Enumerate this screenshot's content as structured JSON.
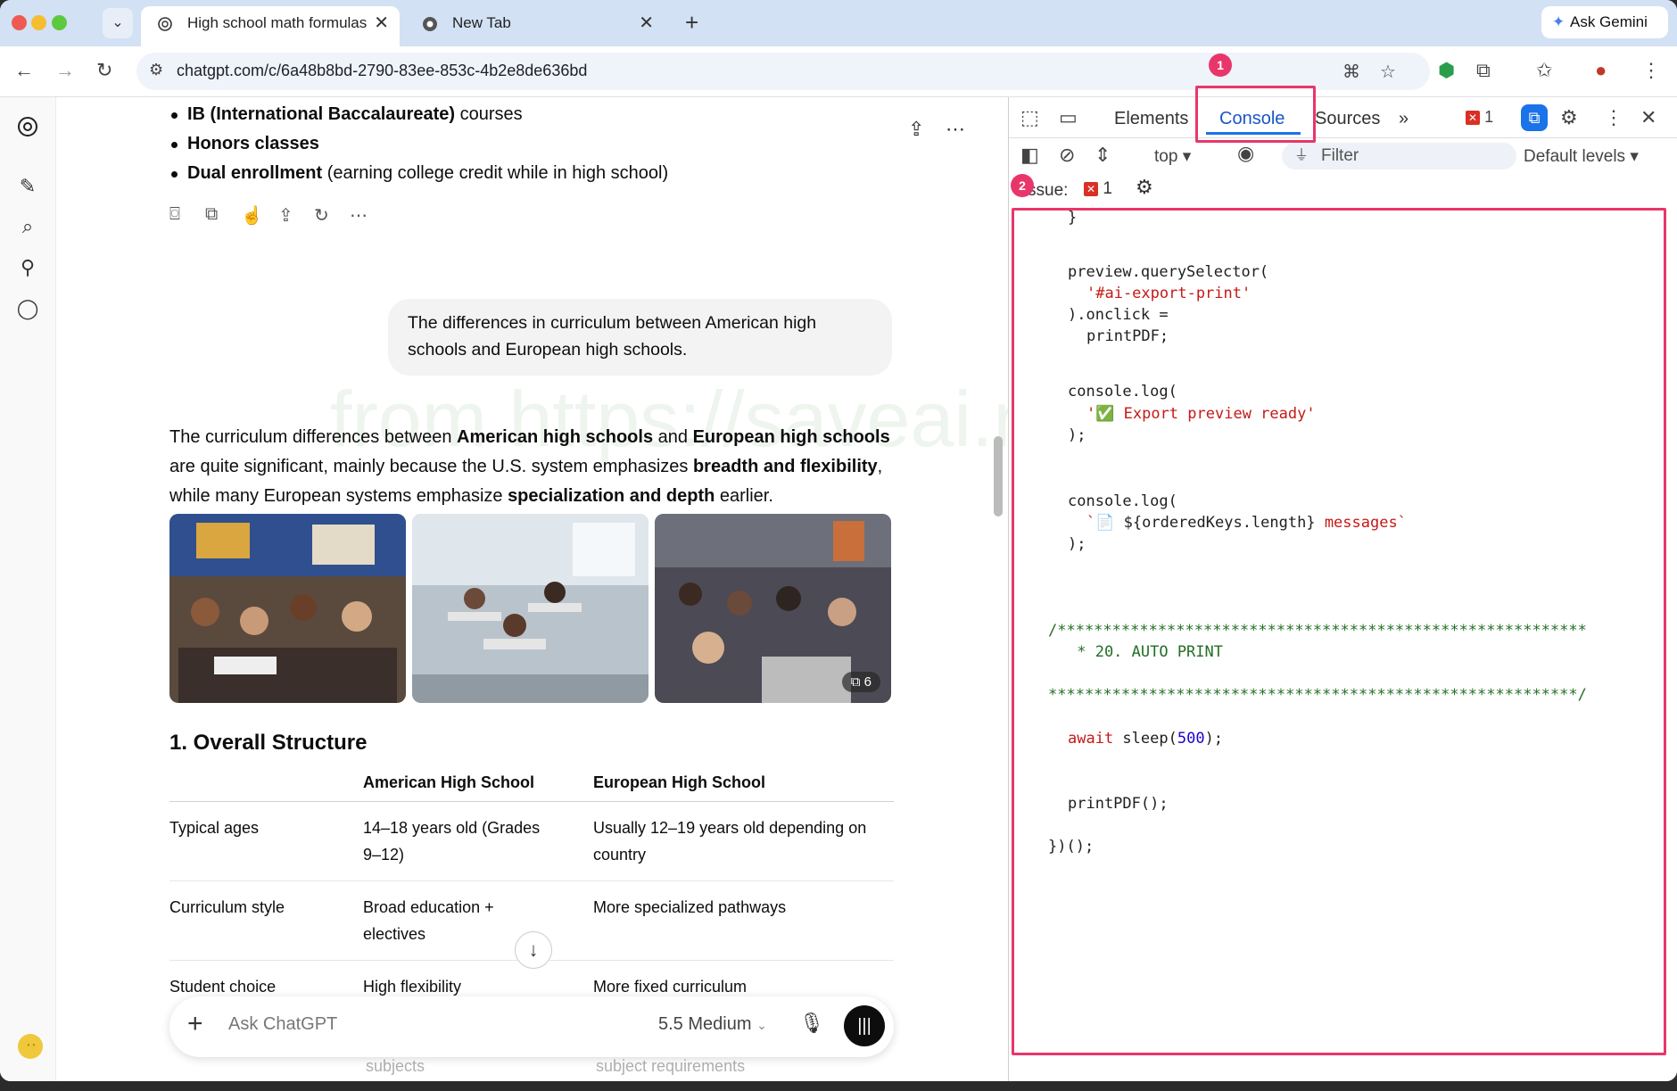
{
  "browser": {
    "tabs": [
      {
        "title": "High school math formulas",
        "active": true
      },
      {
        "title": "New Tab",
        "active": false
      }
    ],
    "ask_gemini": "Ask Gemini",
    "url": "chatgpt.com/c/6a48b8bd-2790-83ee-853c-4b2e8de636bd"
  },
  "chat": {
    "bullets": [
      {
        "bold": "IB (International Baccalaureate)",
        "rest": " courses"
      },
      {
        "bold": "Honors classes",
        "rest": ""
      },
      {
        "bold": "Dual enrollment",
        "rest": " (earning college credit while in high school)"
      }
    ],
    "user_message": "The differences in curriculum between American high schools and European high schools.",
    "response_intro": {
      "p1": "The curriculum differences between ",
      "b1": "American high schools",
      "p2": " and ",
      "b2": "European high schools",
      "p3": " are quite significant, mainly because the U.S. system emphasizes ",
      "b3": "breadth and flexibility",
      "p4": ", while many European systems emphasize ",
      "b4": "specialization and depth",
      "p5": " earlier."
    },
    "image_count": "6",
    "section_heading": "1. Overall Structure",
    "table": {
      "headers": [
        "",
        "American High School",
        "European High School"
      ],
      "rows": [
        [
          "Typical ages",
          "14–18 years old (Grades 9–12)",
          "Usually 12–19 years old depending on country"
        ],
        [
          "Curriculum style",
          "Broad education + electives",
          "More specialized pathways"
        ],
        [
          "Student choice",
          "High flexibility",
          "More fixed curriculum"
        ]
      ],
      "partial_row": [
        "subjects",
        "subject requirements"
      ]
    },
    "watermark": "from https://saveai.net",
    "composer": {
      "placeholder": "Ask ChatGPT",
      "model": "5.5 Medium"
    }
  },
  "devtools": {
    "tabs": [
      "Elements",
      "Console",
      "Sources"
    ],
    "active_tab": "Console",
    "error_count": "1",
    "context": "top",
    "filter_placeholder": "Filter",
    "levels": "Default levels",
    "issues_label": "ssue:",
    "issues_count": "1",
    "callouts": [
      "1",
      "2"
    ],
    "code": {
      "l1": "}",
      "l2": "preview.querySelector(",
      "l3": "'#ai-export-print'",
      "l4": ").onclick =",
      "l5": "printPDF;",
      "l6": "console.log(",
      "l7": "'✅ Export preview ready'",
      "l8": ");",
      "l9": "console.log(",
      "l10a": "`📄 ",
      "l10b": "${orderedKeys.length}",
      "l10c": " messages`",
      "l11": ");",
      "l12": "/**********************************************************",
      "l13": " * 20. AUTO PRINT",
      "l14": "**********************************************************/",
      "l15a": "await",
      "l15b": " sleep(",
      "l15c": "500",
      "l15d": ");",
      "l16": "printPDF();",
      "l17": "})();"
    }
  }
}
